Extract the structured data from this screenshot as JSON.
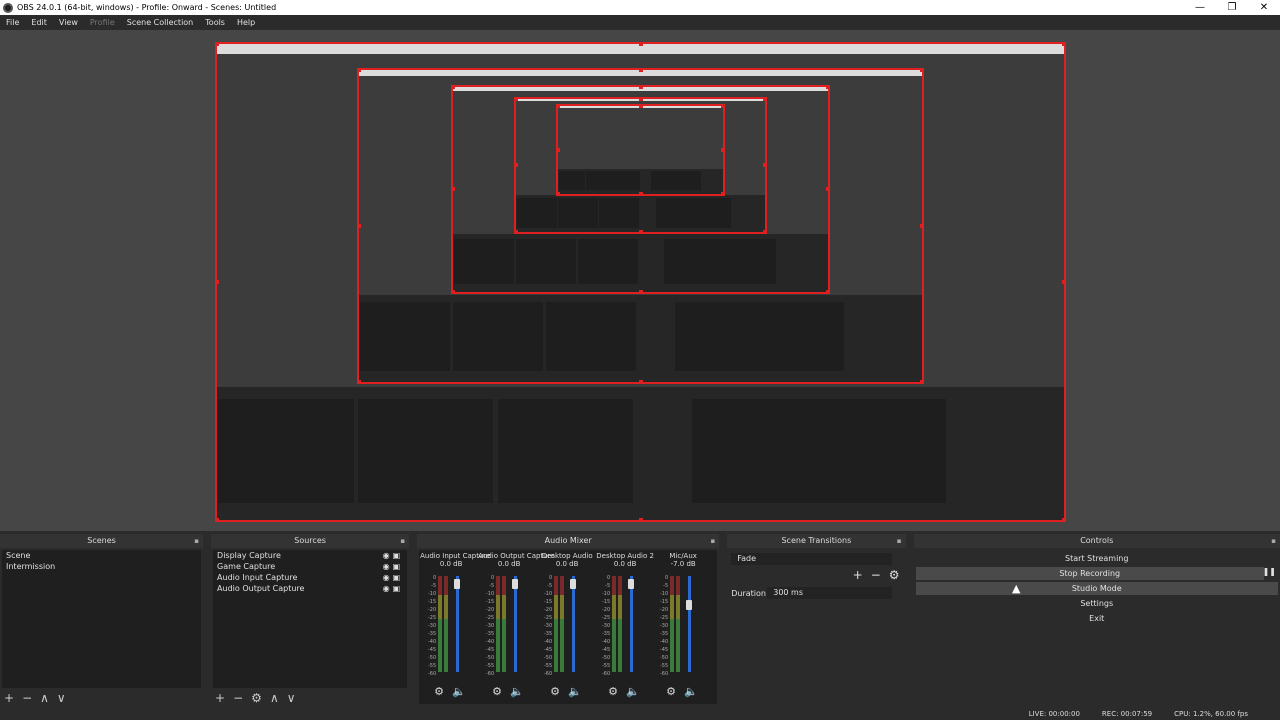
{
  "window": {
    "title": "OBS 24.0.1 (64-bit, windows) - Profile: Onward - Scenes: Untitled",
    "minimize": "—",
    "restore": "❐",
    "close": "✕"
  },
  "menu": [
    {
      "label": "File",
      "enabled": true
    },
    {
      "label": "Edit",
      "enabled": true
    },
    {
      "label": "View",
      "enabled": true
    },
    {
      "label": "Profile",
      "enabled": false
    },
    {
      "label": "Scene Collection",
      "enabled": true
    },
    {
      "label": "Tools",
      "enabled": true
    },
    {
      "label": "Help",
      "enabled": true
    }
  ],
  "scenes": {
    "title": "Scenes",
    "items": [
      "Scene",
      "Intermission"
    ]
  },
  "sources": {
    "title": "Sources",
    "items": [
      "Display Capture",
      "Game Capture",
      "Audio Input Capture",
      "Audio Output Capture"
    ]
  },
  "mixer": {
    "title": "Audio Mixer",
    "channels": [
      {
        "name": "Audio Input Capture",
        "db": "0.0 dB",
        "muted": true,
        "level": 0.92
      },
      {
        "name": "Audio Output Capture",
        "db": "0.0 dB",
        "muted": false,
        "level": 0.92
      },
      {
        "name": "Desktop Audio",
        "db": "0.0 dB",
        "muted": true,
        "level": 0.92
      },
      {
        "name": "Desktop Audio 2",
        "db": "0.0 dB",
        "muted": true,
        "level": 0.92
      },
      {
        "name": "Mic/Aux",
        "db": "-7.0 dB",
        "muted": false,
        "level": 0.7
      }
    ],
    "scale": [
      "0",
      "-5",
      "-10",
      "-15",
      "-20",
      "-25",
      "-30",
      "-35",
      "-40",
      "-45",
      "-50",
      "-55",
      "-60"
    ]
  },
  "transitions": {
    "title": "Scene Transitions",
    "selected": "Fade",
    "duration_label": "Duration",
    "duration_value": "300 ms"
  },
  "controls": {
    "title": "Controls",
    "buttons": [
      {
        "label": "Start Streaming",
        "active": false
      },
      {
        "label": "Stop Recording",
        "active": true
      },
      {
        "label": "Studio Mode",
        "active": true
      },
      {
        "label": "Settings",
        "active": false
      },
      {
        "label": "Exit",
        "active": false
      }
    ],
    "pause": "❚❚"
  },
  "status": {
    "live": "LIVE: 00:00:00",
    "rec": "REC: 00:07:59",
    "cpu": "CPU: 1.2%, 60.00 fps"
  },
  "icons": {
    "add": "+",
    "remove": "−",
    "up": "∧",
    "down": "∨",
    "gear": "⚙",
    "pin": "▪",
    "eye_lock": "◉▣",
    "speaker": "🔈"
  }
}
